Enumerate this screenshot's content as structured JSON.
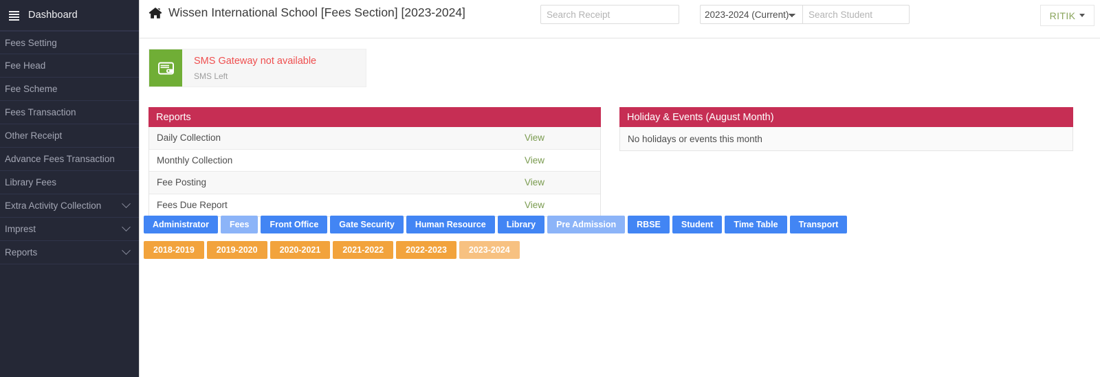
{
  "sidebar": {
    "header": {
      "label": "Dashboard",
      "icon": "hamburger-icon"
    },
    "items": [
      {
        "label": "Fees Setting",
        "expandable": false
      },
      {
        "label": "Fee Head",
        "expandable": false
      },
      {
        "label": "Fee Scheme",
        "expandable": false
      },
      {
        "label": "Fees Transaction",
        "expandable": false
      },
      {
        "label": "Other Receipt",
        "expandable": false
      },
      {
        "label": "Advance Fees Transaction",
        "expandable": false
      },
      {
        "label": "Library Fees",
        "expandable": false
      },
      {
        "label": "Extra Activity Collection",
        "expandable": true
      },
      {
        "label": "Imprest",
        "expandable": true
      },
      {
        "label": "Reports",
        "expandable": true
      }
    ]
  },
  "topbar": {
    "home_icon": "home-icon",
    "title": "Wissen International School [Fees Section] [2023-2024]",
    "search_receipt_placeholder": "Search Receipt",
    "search_receipt_value": "",
    "session_selected": "2023-2024 (Current)",
    "session_options": [
      "2023-2024 (Current)"
    ],
    "search_student_placeholder": "Search Student",
    "search_student_value": "",
    "user_name": "RITIK",
    "caret_icon": "caret-down-icon"
  },
  "sms_card": {
    "icon": "wallet-icon",
    "title": "SMS Gateway not available",
    "subtitle": "SMS Left",
    "icon_bg": "#70ae36",
    "title_color": "#ef4f4f"
  },
  "reports_panel": {
    "title": "Reports",
    "header_color": "#c62e54",
    "rows": [
      {
        "name": "Daily Collection",
        "action": "View"
      },
      {
        "name": "Monthly Collection",
        "action": "View"
      },
      {
        "name": "Fee Posting",
        "action": "View"
      },
      {
        "name": "Fees Due Report",
        "action": "View"
      }
    ]
  },
  "holiday_panel": {
    "title": "Holiday & Events (August Month)",
    "empty_text": "No holidays or events this month",
    "header_color": "#c62e54"
  },
  "module_tabs": {
    "accent": "#4285f4",
    "active_accent": "#8cb4f8",
    "items": [
      {
        "label": "Administrator",
        "active": false
      },
      {
        "label": "Fees",
        "active": true
      },
      {
        "label": "Front Office",
        "active": false
      },
      {
        "label": "Gate Security",
        "active": false
      },
      {
        "label": "Human Resource",
        "active": false
      },
      {
        "label": "Library",
        "active": false
      },
      {
        "label": "Pre Admission",
        "active": true
      },
      {
        "label": "RBSE",
        "active": false
      },
      {
        "label": "Student",
        "active": false
      },
      {
        "label": "Time Table",
        "active": false
      },
      {
        "label": "Transport",
        "active": false
      }
    ]
  },
  "year_tabs": {
    "accent": "#f2a33c",
    "active_accent": "#f7c181",
    "items": [
      {
        "label": "2018-2019",
        "active": false
      },
      {
        "label": "2019-2020",
        "active": false
      },
      {
        "label": "2020-2021",
        "active": false
      },
      {
        "label": "2021-2022",
        "active": false
      },
      {
        "label": "2022-2023",
        "active": false
      },
      {
        "label": "2023-2024",
        "active": true
      }
    ]
  }
}
